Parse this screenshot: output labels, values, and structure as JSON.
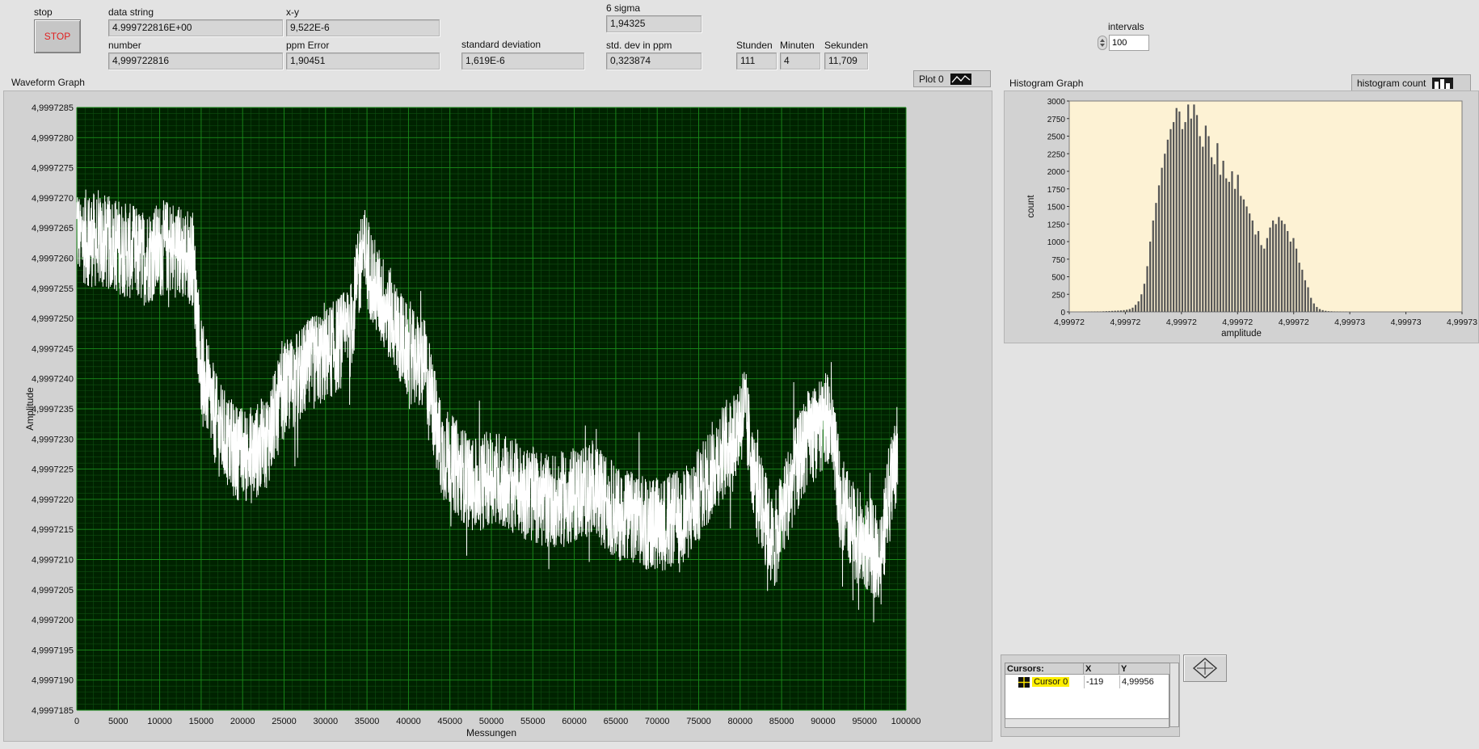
{
  "controls": {
    "stop_label": "stop",
    "stop_button_text": "STOP",
    "data_string_label": "data string",
    "data_string_value": "4.999722816E+00",
    "number_label": "number",
    "number_value": "4,999722816",
    "xy_label": "x-y",
    "xy_value": "9,522E-6",
    "ppm_error_label": "ppm Error",
    "ppm_error_value": "1,90451",
    "std_dev_label": "standard deviation",
    "std_dev_value": "1,619E-6",
    "six_sigma_label": "6 sigma",
    "six_sigma_value": "1,94325",
    "std_dev_ppm_label": "std. dev in ppm",
    "std_dev_ppm_value": "0,323874",
    "hours_label": "Stunden",
    "hours_value": "111",
    "minutes_label": "Minuten",
    "minutes_value": "4",
    "seconds_label": "Sekunden",
    "seconds_value": "11,709",
    "intervals_label": "intervals",
    "intervals_value": "100"
  },
  "waveform": {
    "title": "Waveform Graph",
    "legend_label": "Plot 0"
  },
  "histogram": {
    "title": "Histogram Graph",
    "legend_label": "histogram count"
  },
  "cursors": {
    "header_name": "Cursors:",
    "header_x": "X",
    "header_y": "Y",
    "cursor_name": "Cursor 0",
    "cursor_x": "-119",
    "cursor_y": "4,99956"
  },
  "colors": {
    "plot_bg": "#002200",
    "grid": "#1a8a1a",
    "trace": "#ffffff",
    "hist_bg": "#fdf2d4",
    "hist_bar": "#555555",
    "stop_text": "#e02020"
  },
  "chart_data": [
    {
      "type": "line",
      "xlabel": "Messungen",
      "ylabel": "Amplitude",
      "xlim": [
        0,
        100000
      ],
      "ylim": [
        4.9997185,
        4.9997285
      ],
      "x_ticks": [
        0,
        5000,
        10000,
        15000,
        20000,
        25000,
        30000,
        35000,
        40000,
        45000,
        50000,
        55000,
        60000,
        65000,
        70000,
        75000,
        80000,
        85000,
        90000,
        95000,
        100000
      ],
      "y_ticks": [
        "4,9997185",
        "4,9997190",
        "4,9997195",
        "4,9997200",
        "4,9997205",
        "4,9997210",
        "4,9997215",
        "4,9997220",
        "4,9997225",
        "4,9997230",
        "4,9997235",
        "4,9997240",
        "4,9997245",
        "4,9997250",
        "4,9997255",
        "4,9997260",
        "4,9997265",
        "4,9997270",
        "4,9997275",
        "4,9997280",
        "4,9997285"
      ],
      "envelope": {
        "x": [
          0,
          2000,
          5000,
          8000,
          11000,
          14000,
          15000,
          17000,
          19000,
          21000,
          23000,
          25000,
          28000,
          31000,
          33000,
          34500,
          36000,
          38000,
          40000,
          42000,
          44000,
          46000,
          48000,
          50000,
          53000,
          56000,
          59000,
          62000,
          65000,
          68000,
          71000,
          74000,
          77000,
          79000,
          80500,
          82000,
          84000,
          86000,
          88000,
          90000,
          91000,
          92000,
          94000,
          96000,
          97000,
          98000,
          99000
        ],
        "center": [
          4.9997264,
          4.9997263,
          4.9997262,
          4.999726,
          4.9997262,
          4.999726,
          4.9997242,
          4.9997232,
          4.9997228,
          4.9997227,
          4.999723,
          4.9997238,
          4.9997242,
          4.9997245,
          4.9997248,
          4.9997262,
          4.9997255,
          4.999725,
          4.9997244,
          4.9997242,
          4.9997228,
          4.9997225,
          4.9997222,
          4.9997224,
          4.9997222,
          4.999722,
          4.999722,
          4.9997222,
          4.9997218,
          4.9997216,
          4.9997216,
          4.9997218,
          4.9997226,
          4.999723,
          4.9997235,
          4.9997222,
          4.9997212,
          4.9997222,
          4.999723,
          4.9997232,
          4.9997235,
          4.999722,
          4.9997214,
          4.9997212,
          4.999721,
          4.9997222,
          4.9997228
        ],
        "noise": 8e-07
      }
    },
    {
      "type": "bar",
      "xlabel": "amplitude",
      "ylabel": "count",
      "xlim": [
        4.9997185,
        4.9997285
      ],
      "ylim": [
        0,
        3000
      ],
      "x_tick_labels": [
        "4,99972",
        "4,99972",
        "4,99972",
        "4,99972",
        "4,99972",
        "4,99973",
        "4,99973",
        "4,99973"
      ],
      "y_ticks": [
        0,
        250,
        500,
        750,
        1000,
        1250,
        1500,
        1750,
        2000,
        2250,
        2500,
        2750,
        3000
      ],
      "values": [
        2,
        3,
        4,
        5,
        6,
        6,
        8,
        10,
        12,
        14,
        16,
        18,
        20,
        25,
        30,
        40,
        60,
        100,
        150,
        250,
        400,
        650,
        1000,
        1300,
        1550,
        1800,
        2050,
        2250,
        2450,
        2600,
        2700,
        2900,
        2850,
        2600,
        2700,
        2950,
        2750,
        2950,
        2800,
        2500,
        2350,
        2650,
        2500,
        2200,
        2100,
        2400,
        1950,
        2150,
        1900,
        1850,
        2000,
        1750,
        1950,
        1650,
        1600,
        1500,
        1400,
        1300,
        1100,
        1150,
        950,
        900,
        1050,
        1200,
        1300,
        1250,
        1350,
        1300,
        1250,
        1150,
        1000,
        1050,
        900,
        700,
        600,
        450,
        350,
        200,
        120,
        70,
        40,
        25,
        15,
        10,
        8,
        6,
        5,
        4,
        3,
        3
      ]
    }
  ]
}
